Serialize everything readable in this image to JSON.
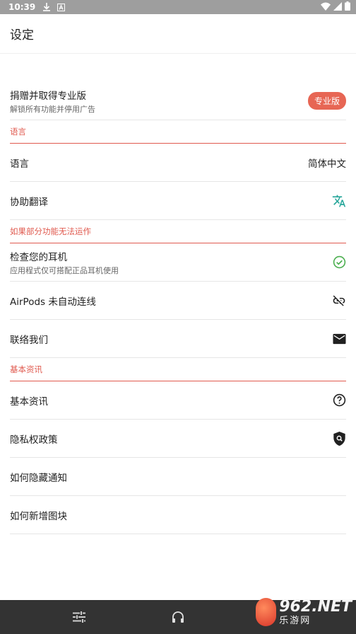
{
  "status_bar": {
    "time": "10:39"
  },
  "app_bar": {
    "title": "设定"
  },
  "pro_row": {
    "title": "捐赠并取得专业版",
    "subtitle": "解锁所有功能并停用广告",
    "badge": "专业版"
  },
  "sections": {
    "language": "语言",
    "troubleshoot": "如果部分功能无法运作",
    "basic": "基本资讯"
  },
  "language_rows": {
    "language_label": "语言",
    "language_value": "简体中文",
    "translate_label": "协助翻译"
  },
  "troubleshoot_rows": {
    "check_title": "检查您的耳机",
    "check_subtitle": "应用程式仅可搭配正品耳机使用",
    "airpods_label": "AirPods 未自动连线",
    "contact_label": "联络我们"
  },
  "basic_rows": {
    "info_label": "基本资讯",
    "privacy_label": "隐私权政策",
    "hide_notif_label": "如何隐藏通知",
    "add_tile_label": "如何新增图块"
  },
  "watermark": {
    "number": "962",
    "suffix": ".NET",
    "sub": "乐游网"
  },
  "colors": {
    "accent": "#e05a4f",
    "badge": "#e76654",
    "check_green": "#4caf50",
    "translate_teal": "#26a69a",
    "status_bar": "#9e9e9e",
    "nav_bar": "#333333"
  }
}
